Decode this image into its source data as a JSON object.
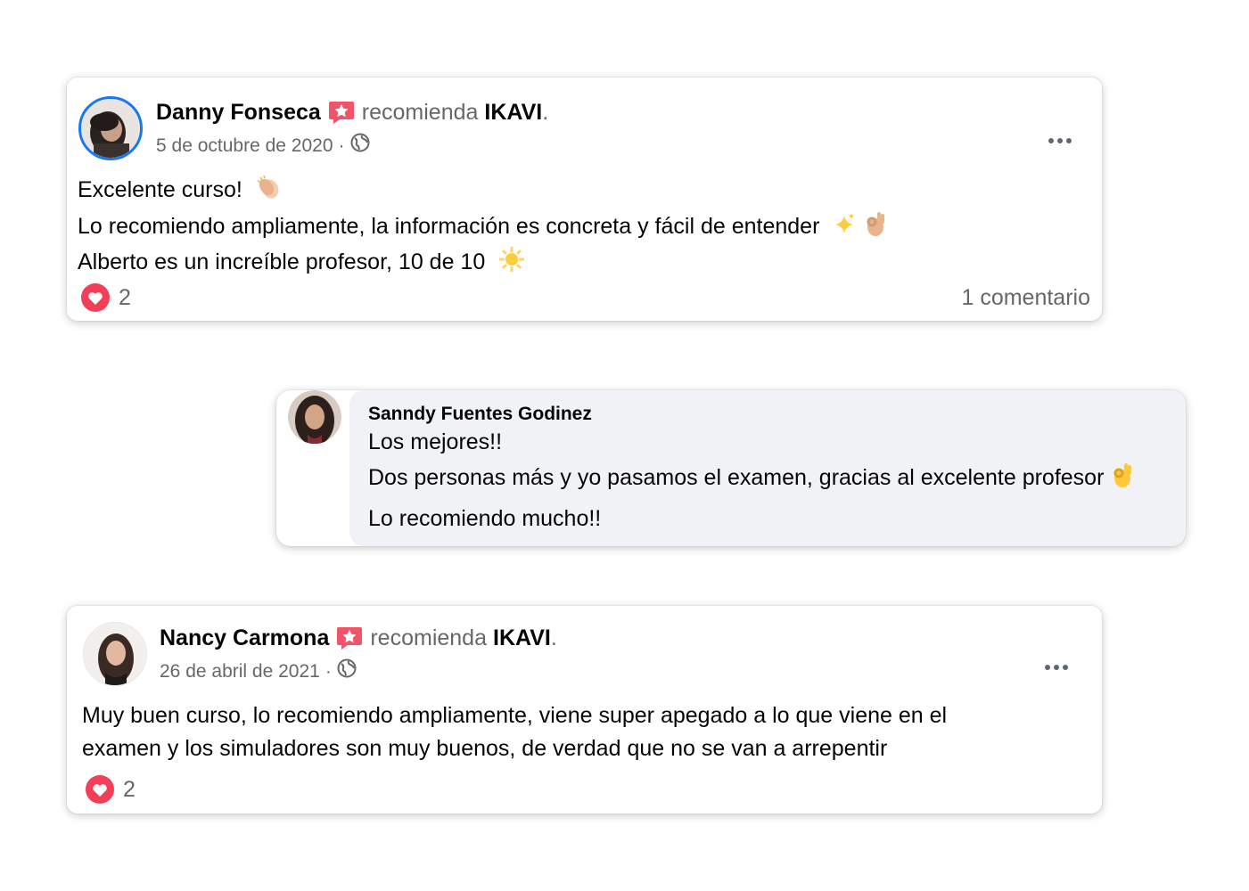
{
  "posts": [
    {
      "author": "Danny Fonseca",
      "action": "recomienda",
      "page": "IKAVI",
      "date": "5 de octubre de 2020",
      "separator": "·",
      "lines": [
        "Excelente curso!",
        "Lo recomiendo ampliamente, la información es concreta y fácil de entender",
        "Alberto es un increíble profesor, 10 de 10"
      ],
      "reactions": "2",
      "comments": "1 comentario"
    },
    {
      "author": "Nancy Carmona",
      "action": "recomienda",
      "page": "IKAVI",
      "date": "26 de abril de 2021",
      "separator": "·",
      "lines": [
        "Muy buen curso, lo recomiendo ampliamente, viene super apegado a lo que viene en el",
        "examen y los simuladores son muy buenos, de verdad que no se van a arrepentir"
      ],
      "reactions": "2"
    }
  ],
  "comment": {
    "author": "Sanndy Fuentes Godinez",
    "lines": [
      "Los mejores!!",
      "Dos personas más y yo pasamos el examen, gracias al excelente profesor",
      "Lo recomiendo mucho!!"
    ]
  },
  "icons": {
    "badge": "recommend-badge-icon",
    "globe": "globe-icon",
    "heart": "heart-reaction-icon",
    "more": "more-options-icon",
    "emoji_clap": "clapping-hands-emoji",
    "emoji_sparkles": "sparkles-emoji",
    "emoji_ok": "ok-hand-emoji",
    "emoji_sun": "sun-emoji"
  },
  "colors": {
    "heart": "#f33e58",
    "badge": "#f35369",
    "avatar_ring": "#1877f2",
    "secondary_text": "#65676b",
    "comment_bg": "#f0f2f5"
  }
}
